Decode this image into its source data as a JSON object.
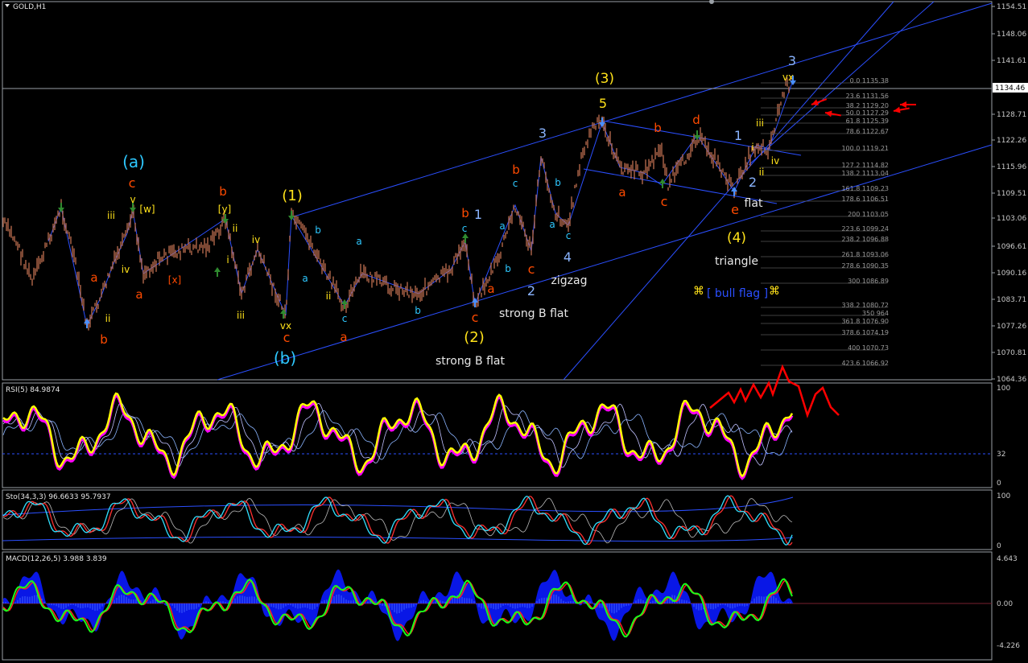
{
  "window": {
    "title": "GOLD,H1"
  },
  "colors": {
    "background": "#000000",
    "frame": "#9aa0a6",
    "channel": "#2b4fff",
    "candle": "#c07050",
    "wave_orange": "#ff4a00",
    "wave_yellow": "#ffe21a",
    "wave_cyan": "#2ec8ff",
    "wave_lightblue": "#8ab4ff",
    "wave_white": "#e8e8e8",
    "rsi": "#ffff00",
    "rsi_shadow": "#ff00ff",
    "macd_hist": "#0a1aff",
    "macd_main": "#19ff19",
    "macd_signal": "#ff2020",
    "arrow": "#ff0000"
  },
  "price_axis": {
    "labels": [
      "1154.51",
      "1148.06",
      "1141.61",
      "1134.46",
      "1128.71",
      "1122.26",
      "1115.96",
      "1109.51",
      "1103.06",
      "1096.61",
      "1090.16",
      "1083.71",
      "1077.26",
      "1070.81",
      "1064.36"
    ],
    "current": "1134.46"
  },
  "fib_levels": [
    "0.0 1135.38",
    "23.6 1131.56",
    "38.2 1129.20",
    "50.0 1127.29",
    "61.8 1125.39",
    "78.6 1122.67",
    "100.0 1119.21",
    "127.2 1114.82",
    "138.2 1113.04",
    "161.8 1109.23",
    "178.6 1106.51",
    "200 1103.05",
    "223.6 1099.24",
    "238.2 1096.88",
    "261.8 1093.06",
    "278.6 1090.35",
    "300 1086.89",
    "338.2 1080.72",
    "350 964",
    "361.8 1076.90",
    "378.6 1074.19",
    "400 1070.73",
    "423.6 1066.92"
  ],
  "annotations": {
    "a_paren": "(a)",
    "b_paren": "(b)",
    "one_paren": "(1)",
    "two_paren": "(2)",
    "three_paren": "(3)",
    "four_paren": "(4)",
    "c": "c",
    "a": "a",
    "b": "b",
    "d": "d",
    "e": "e",
    "vx": "vx",
    "w": "[w]",
    "x": "[x]",
    "y": "[y]",
    "i": "i",
    "ii": "ii",
    "iii": "iii",
    "iv": "iv",
    "v": "v",
    "n1": "1",
    "n2": "2",
    "n3": "3",
    "n4": "4",
    "n5": "5",
    "strong_b_flat": "strong B flat",
    "zigzag": "zigzag",
    "flat": "flat",
    "triangle": "triangle",
    "bull_flag": "[ bull flag ]",
    "flag_glyph": "⌘"
  },
  "panels": {
    "rsi": {
      "title": "RSI(5) 84.9874",
      "levels": [
        "100",
        "32",
        "0"
      ]
    },
    "sto": {
      "title": "Sto(34,3,3) 96.6633 95.7937",
      "levels": [
        "100",
        "0"
      ]
    },
    "macd": {
      "title": "MACD(12,26,5) 3.988 3.839",
      "levels": [
        "4.643",
        "0.00",
        "-4.226"
      ]
    }
  }
}
